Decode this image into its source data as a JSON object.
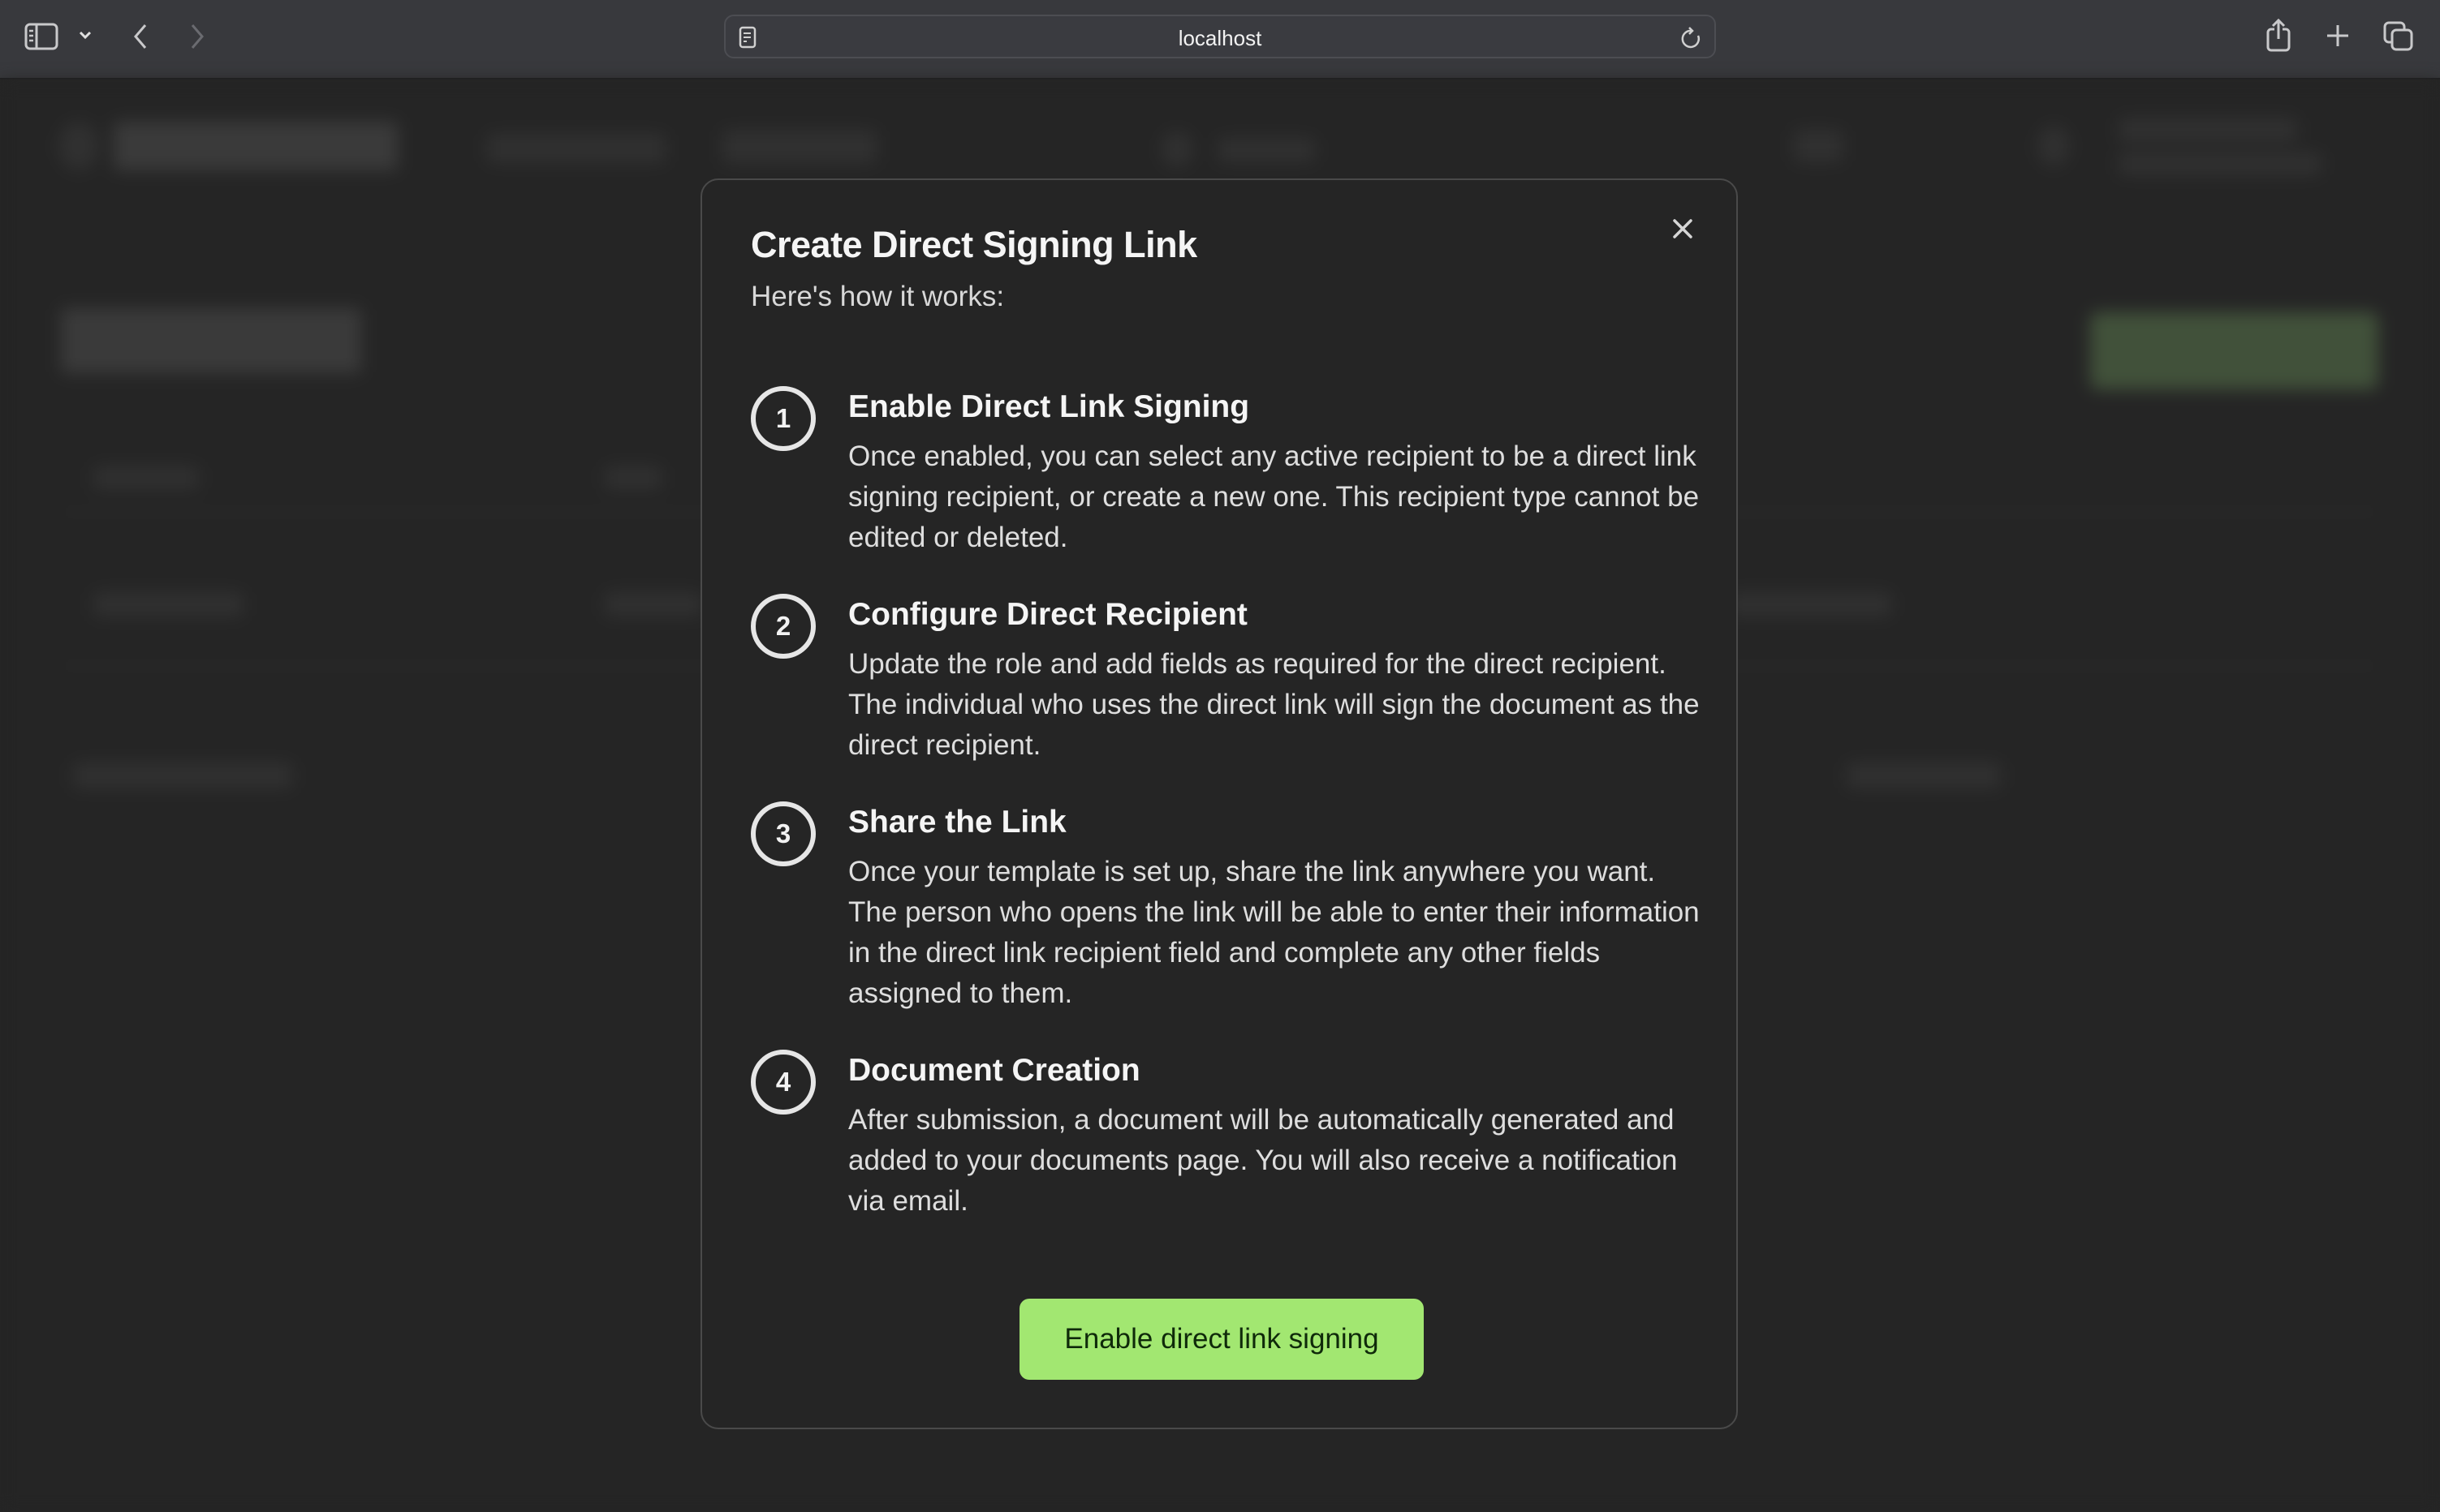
{
  "browser": {
    "url": "localhost",
    "icons": [
      "sidebar-icon",
      "chevron-down-icon",
      "back-icon",
      "forward-icon",
      "page-info-icon",
      "reload-icon",
      "share-icon",
      "new-tab-icon",
      "tabs-overview-icon"
    ]
  },
  "modal": {
    "title": "Create Direct Signing Link",
    "subtitle": "Here's how it works:",
    "close_icon": "close-icon",
    "steps": [
      {
        "number": "1",
        "heading": "Enable Direct Link Signing",
        "description": "Once enabled, you can select any active recipient to be a direct link signing recipient, or create a new one. This recipient type cannot be edited or deleted."
      },
      {
        "number": "2",
        "heading": "Configure Direct Recipient",
        "description": "Update the role and add fields as required for the direct recipient. The individual who uses the direct link will sign the document as the direct recipient."
      },
      {
        "number": "3",
        "heading": "Share the Link",
        "description": "Once your template is set up, share the link anywhere you want. The person who opens the link will be able to enter their information in the direct link recipient field and complete any other fields assigned to them."
      },
      {
        "number": "4",
        "heading": "Document Creation",
        "description": "After submission, a document will be automatically generated and added to your documents page. You will also receive a notification via email."
      }
    ],
    "primary_button": "Enable direct link signing"
  },
  "colors": {
    "primary_button_bg": "#a2e771",
    "primary_button_text": "#0f2a0a",
    "modal_bg": "#252525",
    "chrome_bg": "#38393d"
  }
}
